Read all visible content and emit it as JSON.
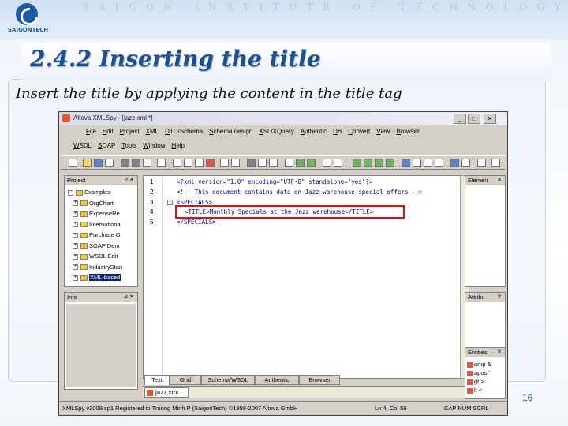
{
  "slide": {
    "institute": "SAIGON INSTITUTE OF TECHNOLOGY",
    "logo_text": "SAIGONTECH",
    "title": "2.4.2 Inserting the title",
    "body": "Insert the title by applying the content in the title tag",
    "page_number": "16"
  },
  "window": {
    "title": "Altova XMLSpy - [jazz.xml *]",
    "buttons": [
      "_",
      "□",
      "✕"
    ]
  },
  "menus": {
    "row1": [
      "File",
      "Edit",
      "Project",
      "XML",
      "DTD/Schema",
      "Schema design",
      "XSL/XQuery",
      "Authentic",
      "DB",
      "Convert",
      "View",
      "Browser"
    ],
    "row2": [
      "WSDL",
      "SOAP",
      "Tools",
      "Window",
      "Help"
    ]
  },
  "project_panel": {
    "title": "Project",
    "items": [
      {
        "label": "Examples",
        "level": 0,
        "expander": "−",
        "selected": false
      },
      {
        "label": "OrgChart",
        "level": 1,
        "expander": "+",
        "selected": false
      },
      {
        "label": "ExpenseRe",
        "level": 1,
        "expander": "+",
        "selected": false
      },
      {
        "label": "Internationa",
        "level": 1,
        "expander": "+",
        "selected": false
      },
      {
        "label": "Purchase O",
        "level": 1,
        "expander": "+",
        "selected": false
      },
      {
        "label": "SOAP Dem",
        "level": 1,
        "expander": "+",
        "selected": false
      },
      {
        "label": "WSDL Edit",
        "level": 1,
        "expander": "+",
        "selected": false
      },
      {
        "label": "IndustryStan",
        "level": 1,
        "expander": "+",
        "selected": false
      },
      {
        "label": "XML-based",
        "level": 1,
        "expander": "+",
        "selected": true
      }
    ]
  },
  "info_panel": {
    "title": "Info"
  },
  "editor": {
    "lines": [
      {
        "num": "1",
        "text": "<?xml version=\"1.0\" encoding=\"UTF-8\" standalone=\"yes\"?>",
        "fold": ""
      },
      {
        "num": "2",
        "text": "<!-- This document contains data on Jazz warehouse special offers -->",
        "fold": ""
      },
      {
        "num": "3",
        "text": "<SPECIALS>",
        "fold": "−"
      },
      {
        "num": "4",
        "text": "<TITLE>Monthly Specials at the Jazz warehouse</TITLE>",
        "fold": ""
      },
      {
        "num": "5",
        "text": "</SPECIALS>",
        "fold": ""
      }
    ]
  },
  "view_tabs": [
    "Text",
    "Grid",
    "Schema/WSDL",
    "Authentic",
    "Browser"
  ],
  "document_tab": "jazz.xml",
  "right_panels": {
    "element_title": "Elemen",
    "attribute_title": "Attribu",
    "entities_title": "Entities",
    "entities": [
      "amp &",
      "apos '",
      "gt >",
      "lt <"
    ]
  },
  "statusbar": {
    "text": "XMLSpy v2008 sp1    Registered to Truong Minh P (SaigonTech)    ©1998-2007 Altova GmbH",
    "position": "Ln 4, Col 58",
    "flags": "CAP  NUM  SCRL"
  }
}
